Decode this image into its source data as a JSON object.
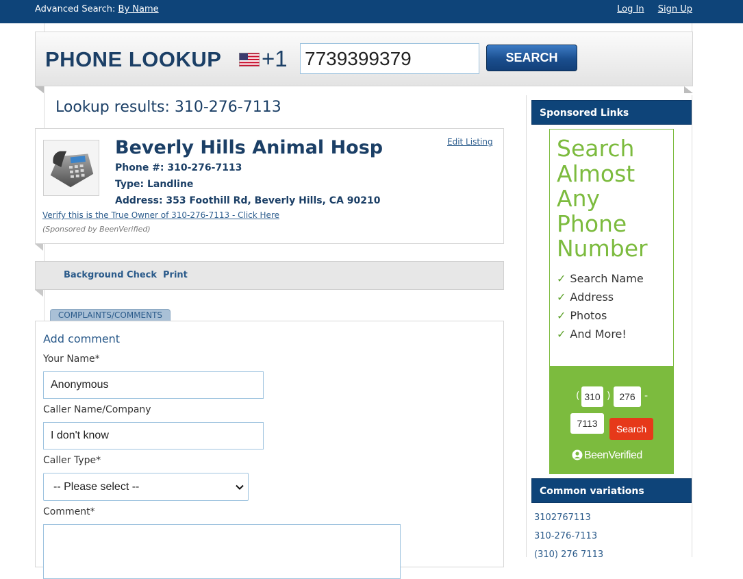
{
  "topbar": {
    "advanced_label": "Advanced Search:",
    "by_name": "By Name",
    "login": "Log In",
    "signup": "Sign Up"
  },
  "lookup": {
    "title": "PHONE LOOKUP",
    "country_code": "+1",
    "input_value": "7739399379",
    "search_label": "SEARCH"
  },
  "results": {
    "title": "Lookup results: 310-276-7113"
  },
  "listing": {
    "name": "Beverly Hills Animal Hosp",
    "phone": "Phone #: 310-276-7113",
    "type": "Type: Landline",
    "address": "Address: 353 Foothill Rd, Beverly Hills, CA 90210",
    "edit_label": "Edit Listing",
    "verify_label": "Verify this is the True Owner of 310-276-7113 - Click Here",
    "sponsored_by": "(Sponsored by BeenVerified)"
  },
  "actions": {
    "background_check": "Background Check",
    "print": "Print"
  },
  "tab": {
    "label": "COMPLAINTS/COMMENTS"
  },
  "form": {
    "heading": "Add comment",
    "your_name_label": "Your Name*",
    "your_name_value": "Anonymous",
    "caller_name_label": "Caller Name/Company",
    "caller_name_value": "I don't know",
    "caller_type_label": "Caller Type*",
    "caller_type_value": "-- Please select --",
    "comment_label": "Comment*"
  },
  "sidebar": {
    "sponsored_title": "Sponsored Links",
    "ad": {
      "headline": "Search Almost Any Phone Number",
      "features": [
        "Search Name",
        "Address",
        "Photos",
        "And More!"
      ],
      "area_code": "310",
      "prefix": "276",
      "line": "7113",
      "open_paren": "(",
      "close_paren": ")",
      "dash": "-",
      "search_label": "Search",
      "logo": "BeenVerified",
      "brand_color": "#7cbb3e"
    },
    "variations_title": "Common variations",
    "variations": [
      "3102767113",
      "310-276-7113",
      "(310) 276 7113"
    ]
  },
  "colors": {
    "navy": "#0e4479",
    "title_blue": "#1b3f66",
    "link_blue": "#2a5a8a",
    "ad_red": "#e6391a"
  }
}
